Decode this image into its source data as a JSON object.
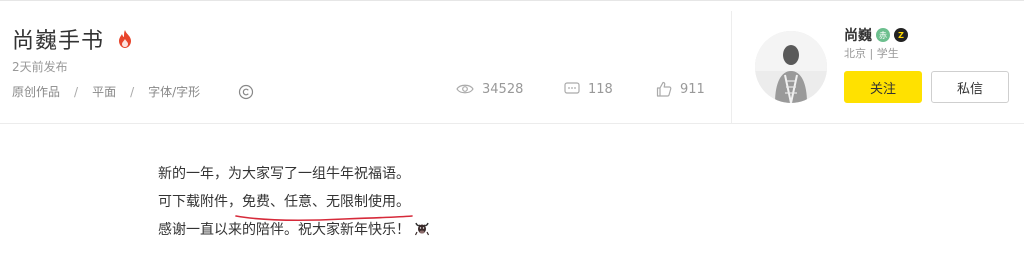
{
  "work": {
    "title": "尚巍手书",
    "time": "2天前发布",
    "category": "原创作品",
    "sep": "/",
    "type": "平面",
    "subtype": "字体/字形"
  },
  "stats": {
    "views": "34528",
    "comments": "118",
    "likes": "911"
  },
  "author": {
    "name": "尚巍",
    "badge_green": "赤",
    "badge_black": "Z",
    "location": "北京",
    "divider": "|",
    "role": "学生",
    "follow_label": "关注",
    "message_label": "私信"
  },
  "content": {
    "line1": "新的一年，为大家写了一组牛年祝福语。",
    "line2_prefix": "可下载附件，",
    "line2_highlight": "免费、任意、无限制使用。",
    "line3": "感谢一直以来的陪伴。祝大家新年快乐！"
  },
  "colors": {
    "accent_yellow": "#ffe100",
    "fire_red": "#e8452c",
    "underline_red": "#d62a3a"
  },
  "icons": {
    "fire": "fire-icon",
    "copyright": "copyright-icon",
    "views": "eye-icon",
    "comments": "comment-icon",
    "likes": "thumbs-up-icon",
    "ox": "ox-emoji-icon"
  }
}
